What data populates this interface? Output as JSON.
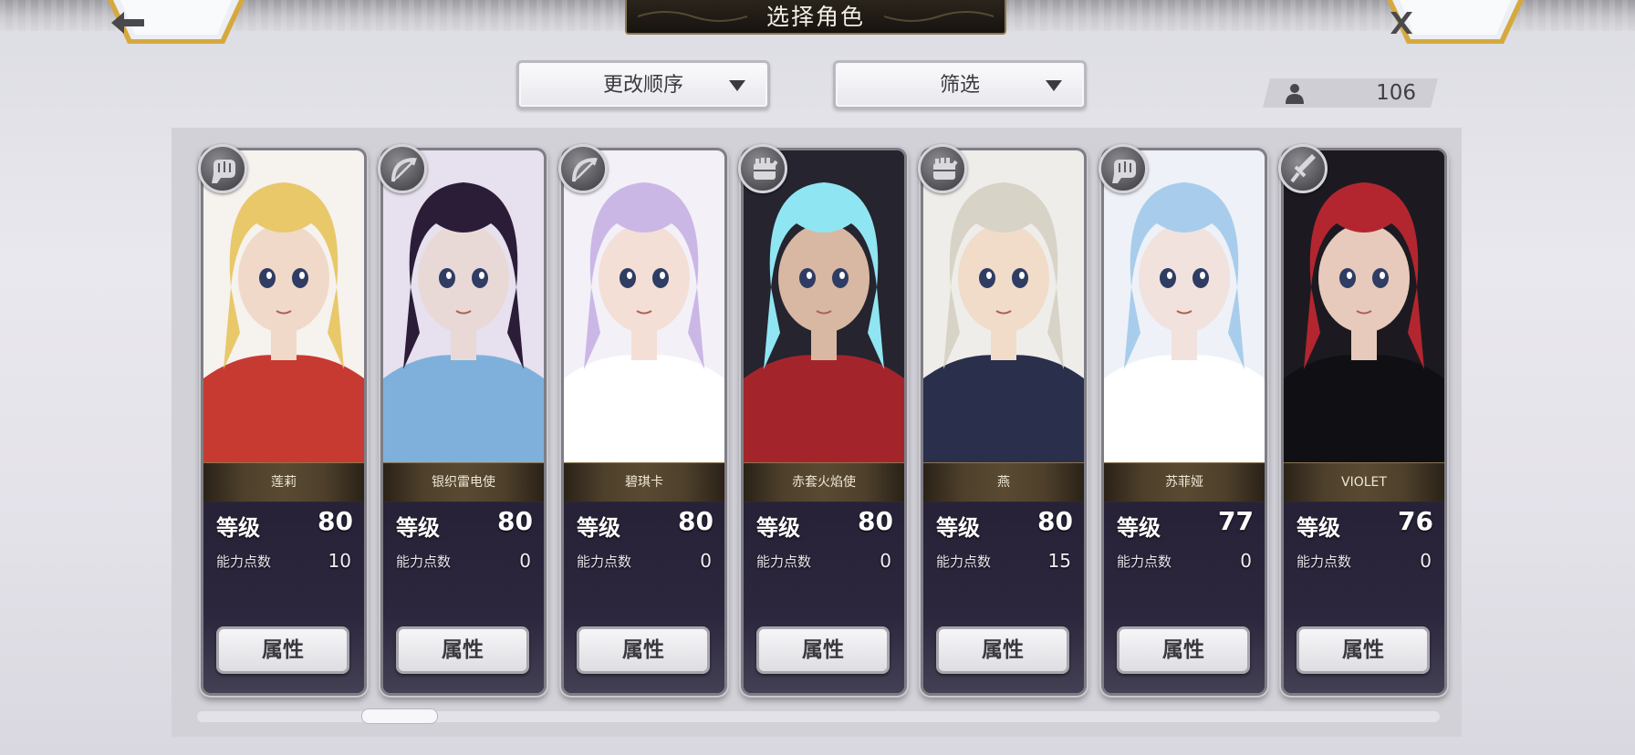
{
  "header": {
    "title": "选择角色",
    "back_icon": "arrow-left-icon",
    "close_icon": "close-icon"
  },
  "controls": {
    "sort_label": "更改顺序",
    "filter_label": "筛选",
    "character_count": "106",
    "count_icon": "person-icon"
  },
  "labels": {
    "level": "等级",
    "ability_points": "能力点数",
    "attribute_button": "属性"
  },
  "characters": [
    {
      "name": "莲莉",
      "level": "80",
      "ability_points": "10",
      "weapon_icon": "fist-icon",
      "portrait_colors": [
        "#f6f2ee",
        "#e9c86a",
        "#c73a32",
        "#f0d9c8"
      ]
    },
    {
      "name": "银织雷电使",
      "level": "80",
      "ability_points": "0",
      "weapon_icon": "bow-icon",
      "portrait_colors": [
        "#e7e0ee",
        "#2b1d37",
        "#7fb0dc",
        "#e9d9d6"
      ]
    },
    {
      "name": "碧琪卡",
      "level": "80",
      "ability_points": "0",
      "weapon_icon": "bow-icon",
      "portrait_colors": [
        "#f3f0f8",
        "#cbb7e6",
        "#ffffff",
        "#f3dfd6"
      ]
    },
    {
      "name": "赤套火焰使",
      "level": "80",
      "ability_points": "0",
      "weapon_icon": "gauntlet-icon",
      "portrait_colors": [
        "#25242f",
        "#8fe6f2",
        "#a3252b",
        "#d8b8a2"
      ]
    },
    {
      "name": "燕",
      "level": "80",
      "ability_points": "15",
      "weapon_icon": "gauntlet-icon",
      "portrait_colors": [
        "#efede9",
        "#d8d3c7",
        "#2a2f4c",
        "#f0dcc8"
      ]
    },
    {
      "name": "苏菲娅",
      "level": "77",
      "ability_points": "0",
      "weapon_icon": "fist-icon",
      "portrait_colors": [
        "#eef1f7",
        "#a8cdec",
        "#ffffff",
        "#f2e2dd"
      ]
    },
    {
      "name": "VIOLET",
      "level": "76",
      "ability_points": "0",
      "weapon_icon": "sword-icon",
      "portrait_colors": [
        "#1c1a20",
        "#b3262f",
        "#101014",
        "#e7cabb"
      ]
    }
  ],
  "colors": {
    "name_text": "#eee7d7",
    "gold_border": "#8b7651",
    "card_bg": "#1f1b2a"
  },
  "scroll": {
    "position": 0.13
  }
}
